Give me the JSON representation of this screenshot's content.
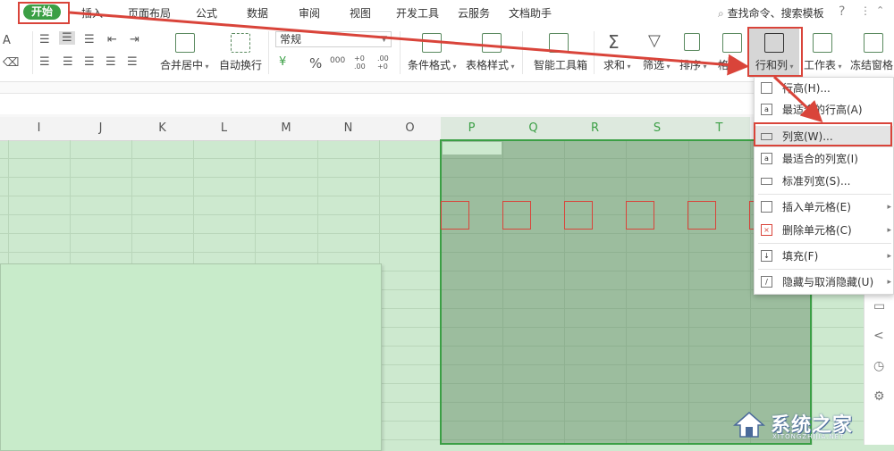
{
  "tabs": {
    "items": [
      "开始",
      "插入",
      "页面布局",
      "公式",
      "数据",
      "审阅",
      "视图",
      "开发工具",
      "云服务",
      "文档助手"
    ],
    "search": "查找命令、搜索模板",
    "help": "?"
  },
  "ribbon": {
    "font_icon": "A",
    "eraser_icon": "eraser",
    "merge_label": "合并居中",
    "wrap_label": "自动换行",
    "number_format": "常规",
    "currency_icon": "¥",
    "percent_icon": "%",
    "thousands_icon": "000",
    "inc_decimal": "+0 .00",
    "dec_decimal": ".00 +0",
    "cond_format": "条件格式",
    "table_style": "表格样式",
    "smart_toolbox": "智能工具箱",
    "sum": "求和",
    "filter": "筛选",
    "sort": "排序",
    "format": "格式",
    "rows_cols": "行和列",
    "worksheet": "工作表",
    "freeze": "冻结窗格"
  },
  "columns": [
    "I",
    "J",
    "K",
    "L",
    "M",
    "N",
    "O",
    "P",
    "Q",
    "R",
    "S",
    "T"
  ],
  "selected_columns": [
    "P",
    "Q",
    "R",
    "S",
    "T"
  ],
  "dropdown": {
    "items": [
      {
        "label": "行高(H)...",
        "icon": "row-height-icon"
      },
      {
        "label": "最适合的行高(A)",
        "icon": "autofit-row-icon"
      },
      {
        "label": "列宽(W)...",
        "icon": "column-width-icon"
      },
      {
        "label": "最适合的列宽(I)",
        "icon": "autofit-column-icon"
      },
      {
        "label": "标准列宽(S)...",
        "icon": "standard-width-icon"
      },
      {
        "label": "插入单元格(E)",
        "icon": "insert-cell-icon",
        "submenu": true
      },
      {
        "label": "删除单元格(C)",
        "icon": "delete-cell-icon",
        "submenu": true
      },
      {
        "label": "填充(F)",
        "icon": "fill-icon",
        "submenu": true
      },
      {
        "label": "隐藏与取消隐藏(U)",
        "icon": "hide-unhide-icon",
        "submenu": true
      }
    ]
  },
  "watermark": {
    "big": "系统之家",
    "small": "XITONGZHIJIA.NET"
  },
  "colors": {
    "accent": "#3b9f45",
    "annotation_red": "#d9443a",
    "sheet_bg": "#cde9cf",
    "selection": "#9cbd9e"
  }
}
